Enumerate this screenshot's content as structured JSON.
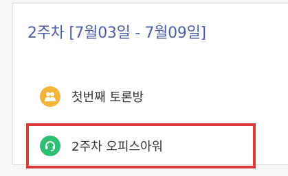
{
  "section": {
    "title": "2주차 [7월03일 - 7월09일]"
  },
  "activities": [
    {
      "label": "첫번째 토론방",
      "icon": "forum-people-icon",
      "icon_color": "#f4b43a"
    },
    {
      "label": "2주차 오피스아워",
      "icon": "headset-icon",
      "icon_color": "#2fbf73"
    }
  ],
  "colors": {
    "title": "#4a5fa8",
    "highlight": "#d93b3b"
  }
}
